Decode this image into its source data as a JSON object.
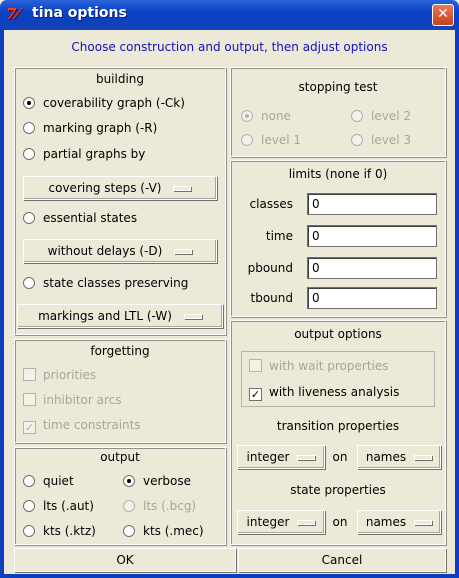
{
  "window": {
    "logo": "7⁄",
    "title": "tina options",
    "close": "✕"
  },
  "header": {
    "instruction": "Choose construction and output, then adjust options"
  },
  "building": {
    "title": "building",
    "options": [
      {
        "label": "coverability graph (-Ck)",
        "checked": true
      },
      {
        "label": "marking graph (-R)",
        "checked": false
      },
      {
        "label": "partial graphs by",
        "checked": false
      },
      {
        "label": "essential states",
        "checked": false
      },
      {
        "label": "state classes preserving",
        "checked": false
      }
    ],
    "partial_menu": "covering steps (-V)",
    "essential_menu": "without delays (-D)",
    "classes_menu": "markings and LTL (-W)"
  },
  "forgetting": {
    "title": "forgetting",
    "options": [
      {
        "label": "priorities",
        "checked": false
      },
      {
        "label": "inhibitor arcs",
        "checked": false
      },
      {
        "label": "time constraints",
        "checked": true
      }
    ]
  },
  "output": {
    "title": "output",
    "options": [
      {
        "label": "quiet",
        "checked": false
      },
      {
        "label": "verbose",
        "checked": true
      },
      {
        "label": "lts (.aut)",
        "checked": false
      },
      {
        "label": "lts (.bcg)",
        "checked": false,
        "disabled": true
      },
      {
        "label": "kts (.ktz)",
        "checked": false
      },
      {
        "label": "kts (.mec)",
        "checked": false
      }
    ]
  },
  "stopping": {
    "title": "stopping test",
    "options": [
      {
        "label": "none",
        "checked": true
      },
      {
        "label": "level 2",
        "checked": false
      },
      {
        "label": "level 1",
        "checked": false
      },
      {
        "label": "level 3",
        "checked": false
      }
    ]
  },
  "limits": {
    "title": "limits (none if 0)",
    "fields": [
      {
        "label": "classes",
        "value": "0"
      },
      {
        "label": "time",
        "value": "0"
      },
      {
        "label": "pbound",
        "value": "0"
      },
      {
        "label": "tbound",
        "value": "0"
      }
    ]
  },
  "output_options": {
    "title": "output options",
    "wait_label": "with wait properties",
    "liveness_label": "with liveness analysis",
    "liveness_checked": true,
    "transition_title": "transition properties",
    "state_title": "state properties",
    "on_label": "on",
    "trans_type": "integer",
    "trans_on": "names",
    "state_type": "integer",
    "state_on": "names"
  },
  "buttons": {
    "ok": "OK",
    "cancel": "Cancel"
  }
}
